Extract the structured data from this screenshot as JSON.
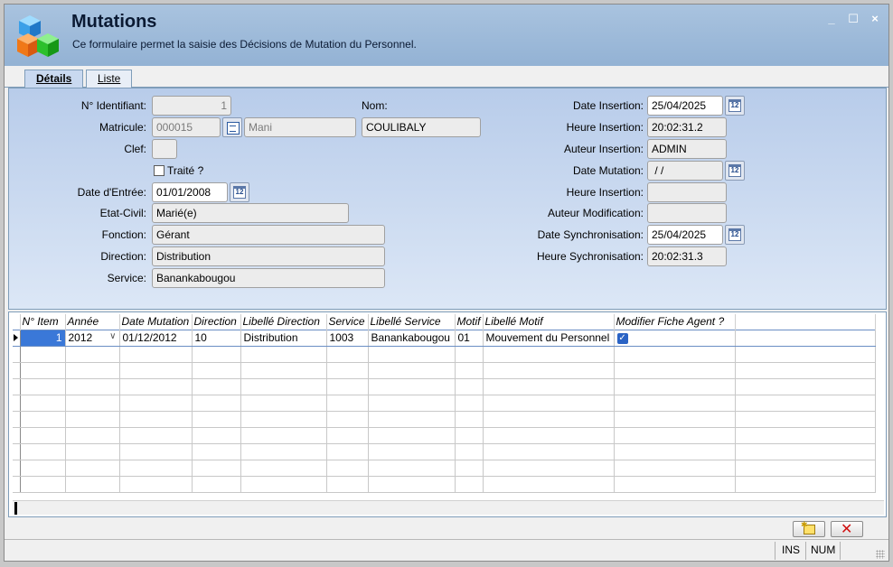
{
  "window": {
    "title": "Mutations",
    "subtitle": "Ce formulaire permet la saisie des Décisions de Mutation du Personnel.",
    "controls": {
      "minimize": "_",
      "maximize": "☐",
      "close": "×"
    }
  },
  "tabs": [
    {
      "label": "Détails",
      "active": true
    },
    {
      "label": "Liste",
      "active": false
    }
  ],
  "form": {
    "identifiant": {
      "label": "N° Identifiant:",
      "value": "1"
    },
    "nom": {
      "label": "Nom:",
      "value": "COULIBALY"
    },
    "matricule": {
      "label": "Matricule:",
      "value": "000015",
      "prenom": "Mani"
    },
    "clef": {
      "label": "Clef:",
      "value": ""
    },
    "traite": {
      "label": "Traité ?",
      "checked": false
    },
    "date_entree": {
      "label": "Date d'Entrée:",
      "value": "01/01/2008"
    },
    "etat_civil": {
      "label": "Etat-Civil:",
      "value": "Marié(e)"
    },
    "fonction": {
      "label": "Fonction:",
      "value": "Gérant"
    },
    "direction": {
      "label": "Direction:",
      "value": "Distribution"
    },
    "service": {
      "label": "Service:",
      "value": "Banankabougou"
    },
    "date_insertion": {
      "label": "Date Insertion:",
      "value": "25/04/2025"
    },
    "heure_insertion": {
      "label": "Heure Insertion:",
      "value": "20:02:31.2"
    },
    "auteur_insertion": {
      "label": "Auteur Insertion:",
      "value": "ADMIN"
    },
    "date_mutation": {
      "label": "Date Mutation:",
      "value": " / /"
    },
    "heure_insertion2": {
      "label": "Heure  Insertion:",
      "value": ""
    },
    "auteur_modification": {
      "label": "Auteur Modification:",
      "value": ""
    },
    "date_synchro": {
      "label": "Date Synchronisation:",
      "value": "25/04/2025"
    },
    "heure_synchro": {
      "label": "Heure Sychronisation:",
      "value": "20:02:31.3"
    },
    "calendar_icon_text": "12"
  },
  "grid": {
    "columns": [
      "N° Item",
      "Année",
      "Date Mutation",
      "Direction",
      "Libellé Direction",
      "Service",
      "Libellé Service",
      "Motif",
      "Libellé Motif",
      "Modifier Fiche Agent ?"
    ],
    "rows": [
      {
        "item": "1",
        "annee": "2012",
        "date_mutation": "01/12/2012",
        "direction": "10",
        "libelle_direction": "Distribution",
        "service": "1003",
        "libelle_service": "Banankabougou",
        "motif": "01",
        "libelle_motif": "Mouvement du Personnel",
        "modifier_fiche": true
      }
    ]
  },
  "statusbar": {
    "ins": "INS",
    "num": "NUM"
  }
}
